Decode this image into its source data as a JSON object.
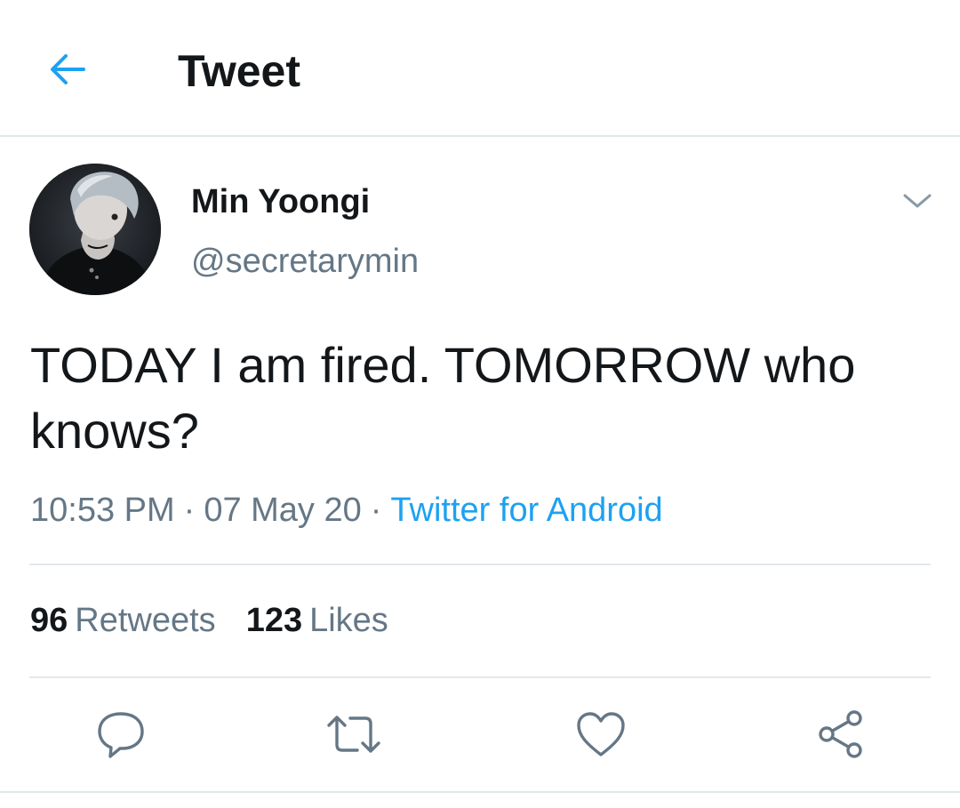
{
  "header": {
    "title": "Tweet",
    "back_icon": "arrow-left-icon"
  },
  "colors": {
    "accent": "#1da1f2",
    "text_primary": "#14171a",
    "text_secondary": "#657786",
    "divider": "#e1e8ed",
    "icon_gray": "#657786"
  },
  "tweet": {
    "author": {
      "name": "Min Yoongi",
      "handle": "@secretarymin",
      "avatar": "user-avatar-photo"
    },
    "text": "TODAY I am fired. TOMORROW who knows?",
    "time": "10:53 PM",
    "date": "07 May 20",
    "separator": "·",
    "source": "Twitter for Android"
  },
  "stats": {
    "retweets_count": "96",
    "retweets_label": "Retweets",
    "likes_count": "123",
    "likes_label": "Likes"
  },
  "actions": [
    {
      "name": "reply",
      "icon": "reply-icon"
    },
    {
      "name": "retweet",
      "icon": "retweet-icon"
    },
    {
      "name": "like",
      "icon": "heart-icon"
    },
    {
      "name": "share",
      "icon": "share-icon"
    }
  ]
}
